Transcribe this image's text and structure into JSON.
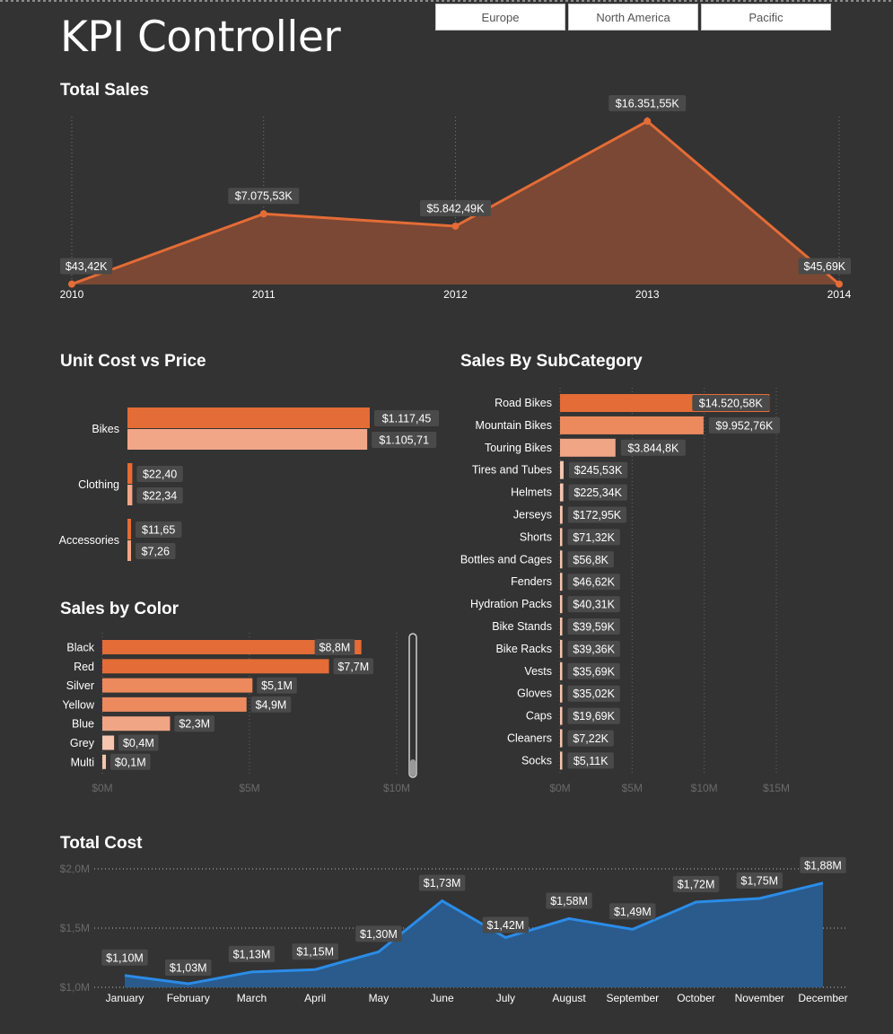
{
  "page": {
    "title": "KPI Controller"
  },
  "slicer": {
    "options": [
      "Europe",
      "North America",
      "Pacific"
    ]
  },
  "chart_data": [
    {
      "type": "area",
      "title": "Total Sales",
      "x": [
        "2010",
        "2011",
        "2012",
        "2013",
        "2014"
      ],
      "values": [
        43.42,
        7075.53,
        5842.49,
        16351.55,
        45.69
      ],
      "labels": [
        "$43,42K",
        "$7.075,53K",
        "$5.842,49K",
        "$16.351,55K",
        "$45,69K"
      ],
      "unit": "K",
      "ylim": [
        0,
        16351.55
      ],
      "grid": "vertical-dotted",
      "color": "#E46C36"
    },
    {
      "type": "bar",
      "orientation": "horizontal",
      "title": "Unit Cost vs Price",
      "categories": [
        "Bikes",
        "Clothing",
        "Accessories"
      ],
      "series": [
        {
          "values": [
            1117.45,
            22.4,
            11.65
          ],
          "labels": [
            "$1.117,45",
            "$22,40",
            "$11,65"
          ],
          "color": "#E46C36"
        },
        {
          "values": [
            1105.71,
            22.34,
            7.26
          ],
          "labels": [
            "$1.105,71",
            "$22,34",
            "$7,26"
          ],
          "color": "#F2A688"
        }
      ]
    },
    {
      "type": "bar",
      "orientation": "horizontal",
      "title": "Sales by Color",
      "categories": [
        "Black",
        "Red",
        "Silver",
        "Yellow",
        "Blue",
        "Grey",
        "Multi"
      ],
      "values": [
        8.8,
        7.7,
        5.1,
        4.9,
        2.3,
        0.4,
        0.1
      ],
      "labels": [
        "$8,8M",
        "$7,7M",
        "$5,1M",
        "$4,9M",
        "$2,3M",
        "$0,4M",
        "$0,1M"
      ],
      "xticks": [
        "$0M",
        "$5M",
        "$10M"
      ],
      "xlim": [
        0,
        10
      ],
      "unit": "M"
    },
    {
      "type": "bar",
      "orientation": "horizontal",
      "title": "Sales By SubCategory",
      "categories": [
        "Road Bikes",
        "Mountain Bikes",
        "Touring Bikes",
        "Tires and Tubes",
        "Helmets",
        "Jerseys",
        "Shorts",
        "Bottles and Cages",
        "Fenders",
        "Hydration Packs",
        "Bike Stands",
        "Bike Racks",
        "Vests",
        "Gloves",
        "Caps",
        "Cleaners",
        "Socks"
      ],
      "values": [
        14520.58,
        9952.76,
        3844.8,
        245.53,
        225.34,
        172.95,
        71.32,
        56.8,
        46.62,
        40.31,
        39.59,
        39.36,
        35.69,
        35.02,
        19.69,
        7.22,
        5.11
      ],
      "labels": [
        "$14.520,58K",
        "$9.952,76K",
        "$3.844,8K",
        "$245,53K",
        "$225,34K",
        "$172,95K",
        "$71,32K",
        "$56,8K",
        "$46,62K",
        "$40,31K",
        "$39,59K",
        "$39,36K",
        "$35,69K",
        "$35,02K",
        "$19,69K",
        "$7,22K",
        "$5,11K"
      ],
      "xticks": [
        "$0M",
        "$5M",
        "$10M",
        "$15M"
      ],
      "xlim": [
        0,
        15000
      ],
      "unit": "K"
    },
    {
      "type": "area",
      "title": "Total Cost",
      "x": [
        "January",
        "February",
        "March",
        "April",
        "May",
        "June",
        "July",
        "August",
        "September",
        "October",
        "November",
        "December"
      ],
      "values": [
        1.1,
        1.03,
        1.13,
        1.15,
        1.3,
        1.73,
        1.42,
        1.58,
        1.49,
        1.72,
        1.75,
        1.88
      ],
      "labels": [
        "$1,10M",
        "$1,03M",
        "$1,13M",
        "$1,15M",
        "$1,30M",
        "$1,73M",
        "$1,42M",
        "$1,58M",
        "$1,49M",
        "$1,72M",
        "$1,75M",
        "$1,88M"
      ],
      "yticks": [
        "$2,0M",
        "$1,5M",
        "$1,0M"
      ],
      "ylim": [
        1.0,
        2.0
      ],
      "unit": "M",
      "color": "#2B8CE8"
    }
  ]
}
